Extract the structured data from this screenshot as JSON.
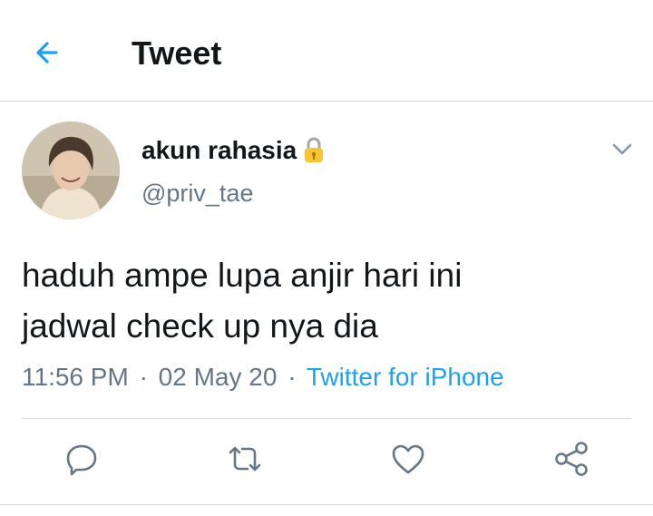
{
  "header": {
    "title": "Tweet",
    "back_icon": "arrow-left-icon",
    "accent": "#1da1f2"
  },
  "tweet": {
    "author_name": "akun rahasia",
    "author_handle": "@priv_tae",
    "lock_icon": "lock-icon",
    "text_line1": "haduh ampe lupa anjir hari ini",
    "text_line2": "jadwal check up nya dia",
    "time": "11:56 PM",
    "separator": "·",
    "date": "02 May 20",
    "source": "Twitter for iPhone"
  },
  "actions": [
    "reply-icon",
    "retweet-icon",
    "like-icon",
    "share-icon"
  ],
  "colors": {
    "text": "#14171a",
    "secondary": "#657786",
    "link": "#1da1f2",
    "divider": "#d6d9dc"
  }
}
